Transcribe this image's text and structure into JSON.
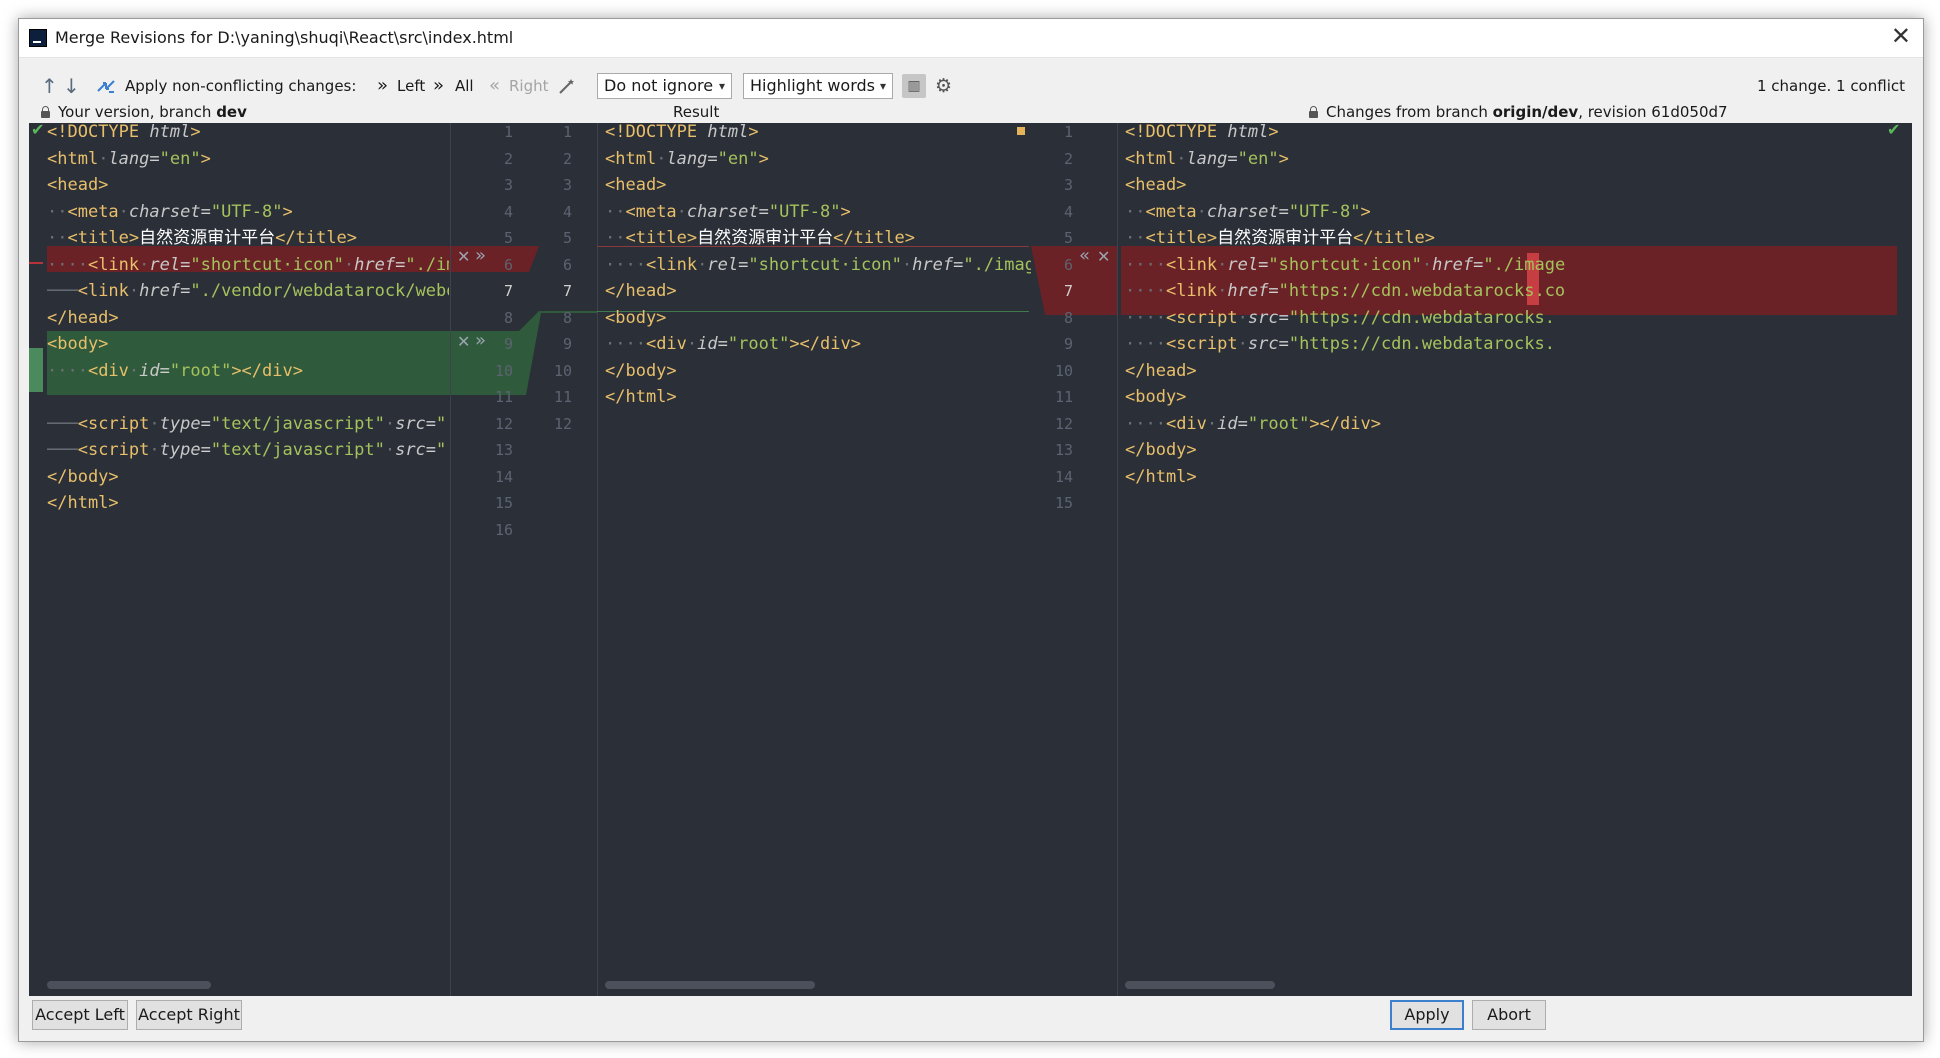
{
  "window": {
    "title": "Merge Revisions for D:\\yaning\\shuqi\\React\\src\\index.html",
    "close_symbol": "✕"
  },
  "toolbar": {
    "prev_symbol": "↑",
    "next_symbol": "↓",
    "apply_label": "Apply non-conflicting changes:",
    "left_label": "Left",
    "all_label": "All",
    "right_label": "Right",
    "ignore_value": "Do not ignore",
    "highlight_value": "Highlight words",
    "summary": "1 change. 1 conflict"
  },
  "headers": {
    "left_prefix": "Your version, branch ",
    "left_branch": "dev",
    "center": "Result",
    "right_prefix": "Changes from branch ",
    "right_branch": "origin/dev",
    "right_suffix": ", revision 61d050d7"
  },
  "panes": {
    "left_numbers": [
      "1",
      "2",
      "3",
      "4",
      "5",
      "6",
      "7",
      "8",
      "9",
      "10",
      "11",
      "12",
      "13",
      "14",
      "15",
      "16"
    ],
    "center_numbers": [
      "1",
      "2",
      "3",
      "4",
      "5",
      "6",
      "7",
      "8",
      "9",
      "10",
      "11",
      "12"
    ],
    "right_numbers": [
      "1",
      "2",
      "3",
      "4",
      "5",
      "6",
      "7",
      "8",
      "9",
      "10",
      "11",
      "12",
      "13",
      "14",
      "15"
    ]
  },
  "colors": {
    "editor_bg": "#2b2f38",
    "conflict": "#6b2226",
    "added": "#2f5b3c",
    "accent": "#3c7fcf"
  },
  "buttons": {
    "accept_left": "Accept Left",
    "accept_right": "Accept Right",
    "apply": "Apply",
    "abort": "Abort"
  }
}
